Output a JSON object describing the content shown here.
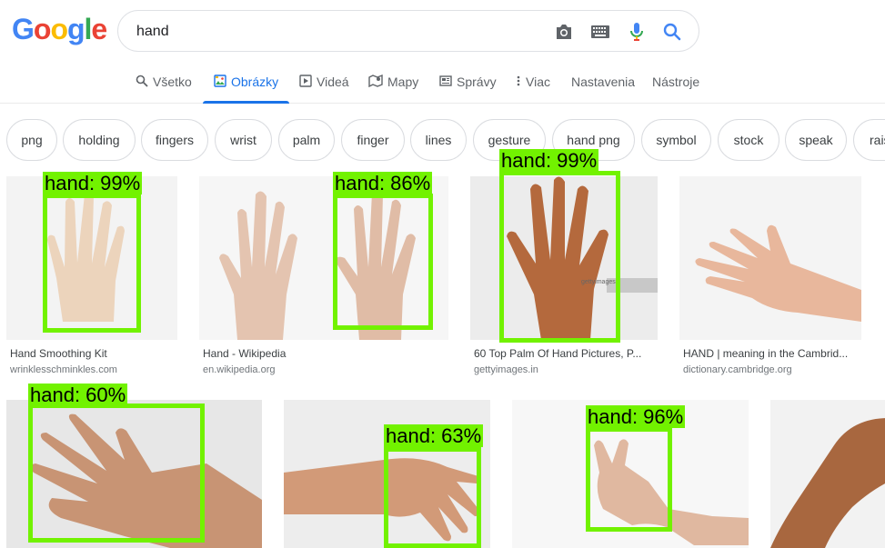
{
  "logo": {
    "text": "Google",
    "letters": [
      "G",
      "o",
      "o",
      "g",
      "l",
      "e"
    ],
    "colors": [
      "#4285f4",
      "#ea4335",
      "#fbbc05",
      "#4285f4",
      "#34a853",
      "#ea4335"
    ]
  },
  "search": {
    "query": "hand",
    "icons": [
      "camera-icon",
      "keyboard-icon",
      "mic-icon",
      "search-icon"
    ]
  },
  "tabs": [
    {
      "label": "Všetko",
      "icon": "search-icon",
      "active": false
    },
    {
      "label": "Obrázky",
      "icon": "image-icon",
      "active": true
    },
    {
      "label": "Videá",
      "icon": "play-icon",
      "active": false
    },
    {
      "label": "Mapy",
      "icon": "map-icon",
      "active": false
    },
    {
      "label": "Správy",
      "icon": "news-icon",
      "active": false
    },
    {
      "label": "Viac",
      "icon": "more-vert-icon",
      "active": false
    },
    {
      "label": "Nastavenia",
      "active": false
    },
    {
      "label": "Nástroje",
      "active": false
    }
  ],
  "chips": [
    "png",
    "holding",
    "fingers",
    "wrist",
    "palm",
    "finger",
    "lines",
    "gesture",
    "hand png",
    "symbol",
    "stock",
    "speak",
    "raise"
  ],
  "results_row1": [
    {
      "title": "Hand Smoothing Kit",
      "site": "wrinklesschminkles.com"
    },
    {
      "title": "Hand - Wikipedia",
      "site": "en.wikipedia.org"
    },
    {
      "title": "60 Top Palm Of Hand Pictures, P...",
      "site": "gettyimages.in"
    },
    {
      "title": "HAND | meaning in the Cambrid...",
      "site": "dictionary.cambridge.org"
    }
  ],
  "detections": [
    {
      "label": "hand: 99%"
    },
    {
      "label": "hand: 86%"
    },
    {
      "label": "hand: 99%"
    },
    {
      "label": "hand: 60%"
    },
    {
      "label": "hand: 63%"
    },
    {
      "label": "hand: 96%"
    }
  ],
  "colors": {
    "accent": "#1a73e8",
    "detection": "#72f200"
  }
}
